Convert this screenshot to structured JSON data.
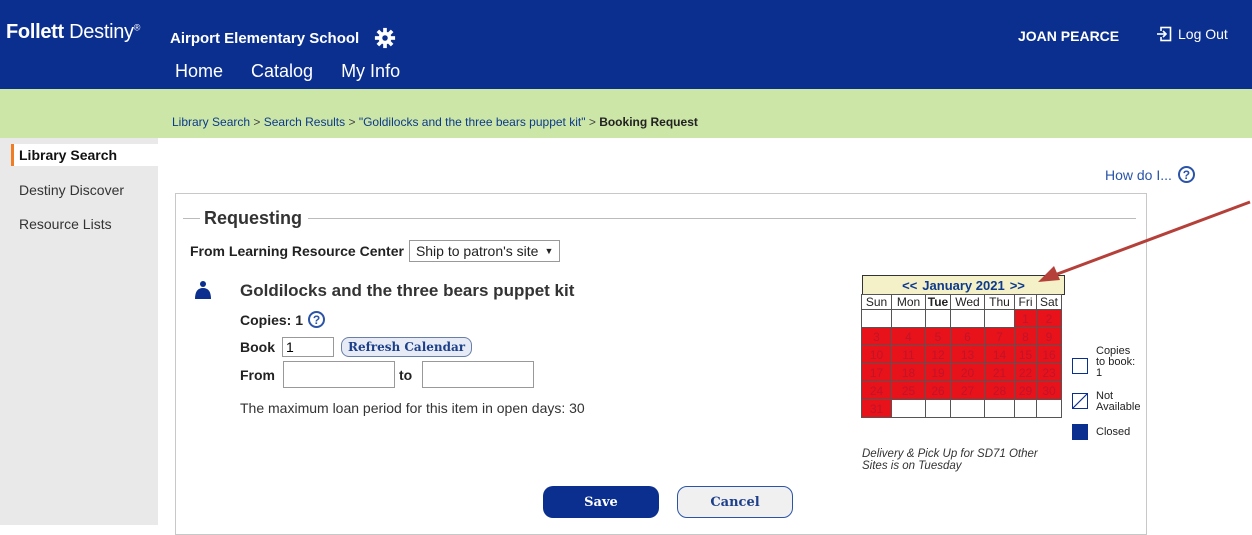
{
  "header": {
    "logo_brand": "Follett",
    "logo_product": "Destiny",
    "logo_mark": "®",
    "school": "Airport Elementary School",
    "user": "JOAN PEARCE",
    "logout": "Log Out",
    "nav": [
      {
        "label": "Home",
        "active": false
      },
      {
        "label": "Catalog",
        "active": true
      },
      {
        "label": "My Info",
        "active": false
      }
    ],
    "colors": {
      "bar": "#0b2f8f",
      "accent": "#f07c24",
      "breadcrumb_bg": "#cce6a7"
    }
  },
  "breadcrumb": {
    "items": [
      "Library Search",
      "Search Results",
      "\"Goldilocks and the three bears puppet kit\""
    ],
    "separator": ">",
    "current": "Booking Request"
  },
  "sidebar": {
    "items": [
      {
        "label": "Library Search",
        "active": true
      },
      {
        "label": "Destiny Discover",
        "active": false
      },
      {
        "label": "Resource Lists",
        "active": false
      }
    ]
  },
  "help": {
    "label": "How do I...",
    "icon": "question-circle-icon"
  },
  "form": {
    "section_title": "Requesting",
    "from_label": "From Learning Resource Center",
    "ship_option": "Ship to patron's site",
    "item_title": "Goldilocks and the three bears puppet kit",
    "copies_label": "Copies: 1",
    "book_label": "Book",
    "book_value": "1",
    "refresh_label": "Refresh Calendar",
    "from_date_label": "From",
    "to_date_label": "to",
    "from_date_value": "",
    "to_date_value": "",
    "max_loan": "The maximum loan period for this item in open days: 30",
    "save_label": "Save",
    "cancel_label": "Cancel"
  },
  "calendar": {
    "prev": "<<",
    "next": ">>",
    "month_label": "January 2021",
    "days": [
      "Sun",
      "Mon",
      "Tue",
      "Wed",
      "Thu",
      "Fri",
      "Sat"
    ],
    "today_dow": "Tue",
    "first_weekday": 5,
    "days_in_month": 31,
    "not_available": [
      1,
      2,
      3,
      4,
      5,
      6,
      7,
      8,
      9,
      10,
      11,
      12,
      13,
      14,
      15,
      16,
      17,
      18,
      19,
      20,
      21,
      22,
      23,
      24,
      25,
      26,
      27,
      28,
      29,
      30,
      31
    ],
    "note": "Delivery & Pick Up for SD71 Other Sites is on Tuesday",
    "legend": [
      {
        "label": "Copies to book: 1",
        "kind": "available"
      },
      {
        "label": "Not Available",
        "kind": "not-available"
      },
      {
        "label": "Closed",
        "kind": "closed"
      }
    ],
    "colors": {
      "not_available": "#e8121b",
      "closed": "#0b2f8f",
      "header": "#f4f0c8"
    }
  }
}
